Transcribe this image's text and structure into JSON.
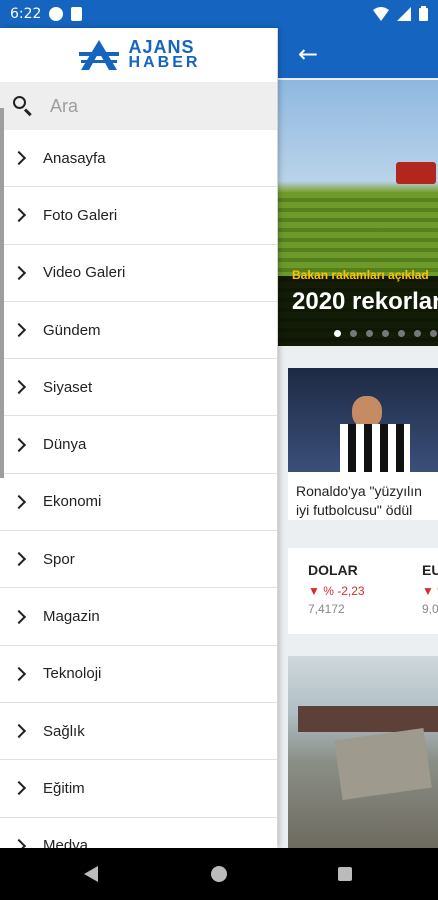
{
  "status_bar": {
    "time": "6:22"
  },
  "drawer": {
    "logo": {
      "line1": "AJANS",
      "line2": "HABER"
    },
    "search": {
      "placeholder": "Ara"
    },
    "items": [
      {
        "label": "Anasayfa"
      },
      {
        "label": "Foto Galeri"
      },
      {
        "label": "Video Galeri"
      },
      {
        "label": "Gündem"
      },
      {
        "label": "Siyaset"
      },
      {
        "label": "Dünya"
      },
      {
        "label": "Ekonomi"
      },
      {
        "label": "Spor"
      },
      {
        "label": "Magazin"
      },
      {
        "label": "Teknoloji"
      },
      {
        "label": "Sağlık"
      },
      {
        "label": "Eğitim"
      },
      {
        "label": "Medya"
      }
    ]
  },
  "app": {
    "hero": {
      "kicker": "Bakan rakamları açıklad",
      "headline": "2020 rekorlar",
      "slide_count": 7,
      "active_slide": 0
    },
    "news_card": {
      "title_line1": "Ronaldo'ya \"yüzyılın",
      "title_line2": "iyi futbolcusu\" ödül"
    },
    "currencies": [
      {
        "name": "DOLAR",
        "change": "▼ % -2,23",
        "value": "7,4172"
      },
      {
        "name": "EU",
        "change": "▼ %",
        "value": "9,0"
      }
    ]
  },
  "colors": {
    "brand": "#1565c0",
    "down": "#d32f2f"
  }
}
